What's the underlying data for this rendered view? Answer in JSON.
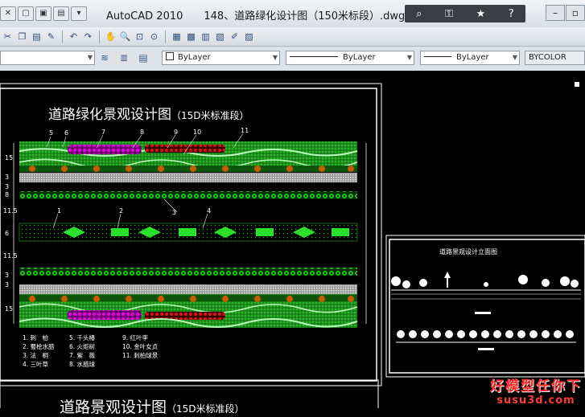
{
  "window": {
    "app_name": "AutoCAD 2010",
    "file_name": "148、道路绿化设计图（150米标段）.dwg"
  },
  "quick_access": [
    "new-icon",
    "open-icon",
    "save-icon",
    "dropdown-icon"
  ],
  "infocenter": [
    "binoculars-icon",
    "key-icon",
    "star-icon",
    "help-icon"
  ],
  "toolbar_icons": [
    "cut-icon",
    "copy-icon",
    "paste-icon",
    "match-icon",
    "undo-icon",
    "redo-icon",
    "pan-icon",
    "zoom-realtime-icon",
    "zoom-window-icon",
    "zoom-previous-icon",
    "properties-icon",
    "design-center-icon",
    "tool-palette-icon",
    "sheet-set-icon",
    "markup-icon",
    "calculator-icon"
  ],
  "properties_bar": {
    "color_value": "ByLayer",
    "linetype_value": "ByLayer",
    "lineweight_value": "ByLayer",
    "plotstyle_value": "BYCOLOR"
  },
  "drawing": {
    "plan_title": "道路绿化景观设计图",
    "plan_subtitle": "（15D米标准段）",
    "elevation_title": "道路景观设计立面图",
    "second_title": "道路景观设计图",
    "second_subtitle": "（15D米标准段）",
    "callouts": [
      "5",
      "6",
      "7",
      "8",
      "9",
      "10",
      "11",
      "1",
      "2",
      "3",
      "4",
      "3"
    ],
    "left_dims": [
      "15",
      "3",
      "3",
      "8",
      "11.5",
      "6",
      "11.5",
      "3",
      "3",
      "15"
    ],
    "legend": [
      [
        "1. 刺　柏",
        "5. 千头椿",
        "9. 红叶李"
      ],
      [
        "2. 蜀桧水腊",
        "6. 火炬树",
        "10. 金叶女贞"
      ],
      [
        "3. 法　桐",
        "7. 紫　薇",
        "11. 刺柏球景"
      ],
      [
        "4. 三叶草",
        "8. 水腊球",
        ""
      ]
    ]
  },
  "watermark": {
    "text": "好模型任你下",
    "url": "susu3d.com"
  },
  "colors": {
    "green": "#22c51e",
    "dark_green": "#0d7a0d",
    "magenta": "#d200d2",
    "red": "#d40000",
    "orange": "#d46a00"
  }
}
